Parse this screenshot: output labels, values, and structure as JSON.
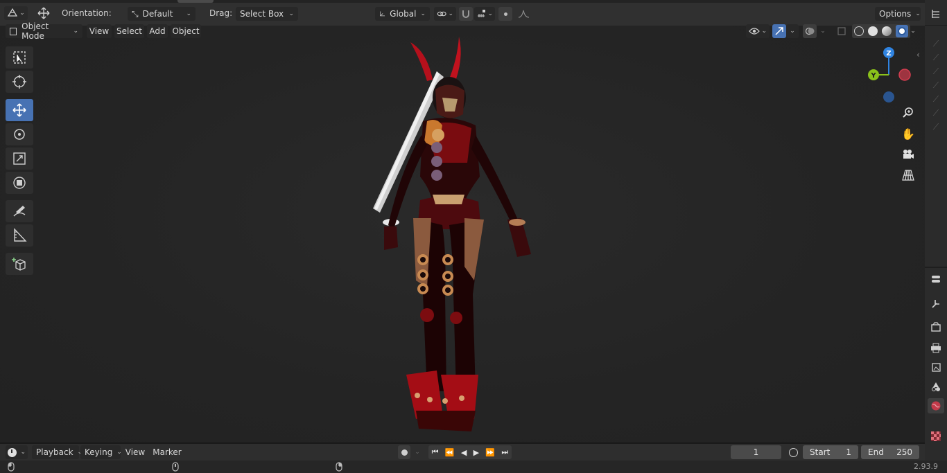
{
  "header": {
    "orientation_label": "Orientation:",
    "orientation_value": "Default",
    "drag_label": "Drag:",
    "drag_value": "Select Box",
    "transform_space": "Global",
    "options_label": "Options"
  },
  "menu": {
    "mode": "Object Mode",
    "items": [
      "View",
      "Select",
      "Add",
      "Object"
    ]
  },
  "gizmo": {
    "z": "Z",
    "y": "Y"
  },
  "timeline": {
    "editor_menus": [
      "Playback",
      "Keying",
      "View",
      "Marker"
    ],
    "current_frame": "1",
    "start_label": "Start",
    "start_value": "1",
    "end_label": "End",
    "end_value": "250"
  },
  "status": {
    "version": "2.93.9"
  },
  "colors": {
    "accent": "#4772b3",
    "gizmo_z": "#2f83e0",
    "gizmo_y": "#8bc11b",
    "gizmo_x": "#d33d4f"
  }
}
